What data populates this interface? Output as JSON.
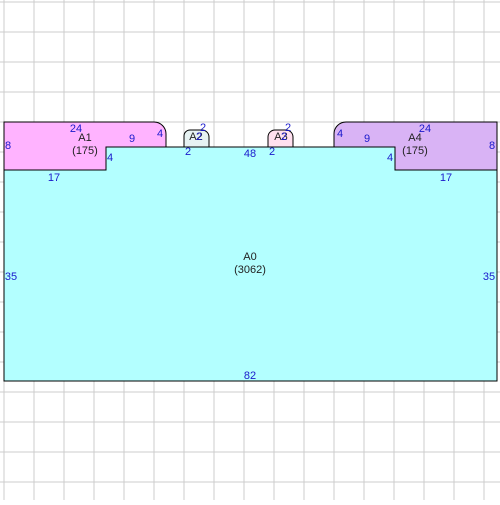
{
  "colors": {
    "grid": "#cccccc",
    "outline": "#000000",
    "dimension_text": "#1a1acc",
    "label_text": "#222222",
    "A0": "#b3ffff",
    "A1": "#ffb3ff",
    "A2": "#e6f2f2",
    "A3": "#ffe0ef",
    "A4": "#d9b3f5"
  },
  "areas": {
    "A0": {
      "name": "A0",
      "value": "(3062)"
    },
    "A1": {
      "name": "A1",
      "value": "(175)"
    },
    "A2": {
      "name": "A2"
    },
    "A3": {
      "name": "A3"
    },
    "A4": {
      "name": "A4",
      "value": "(175)"
    }
  },
  "dimensions": {
    "a1_top": "24",
    "a1_left": "8",
    "a1_inner": "9",
    "a1_round": "4",
    "a1_step": "4",
    "a1_bottom": "17",
    "a2_top": "2",
    "a2_side": "2",
    "a2_base": "2",
    "mid_span": "48",
    "a3_top": "2",
    "a3_side": "2",
    "a3_base": "2",
    "a4_top": "24",
    "a4_right": "8",
    "a4_inner": "9",
    "a4_round": "4",
    "a4_step": "4",
    "a4_bottom": "17",
    "a0_left": "35",
    "a0_right": "35",
    "a0_bottom": "82"
  }
}
